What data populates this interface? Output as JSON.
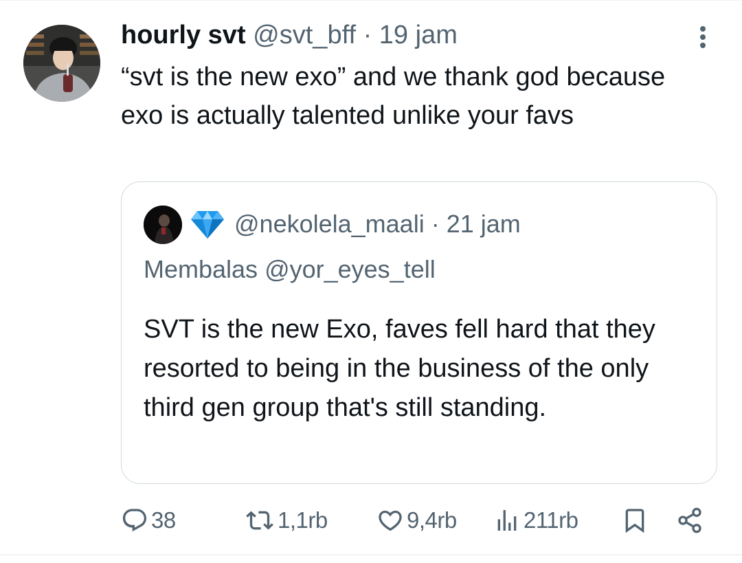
{
  "tweet": {
    "author_name": "hourly svt",
    "handle": "@svt_bff",
    "separator": "·",
    "time": "19 jam",
    "text": "“svt is the new exo” and we thank god because exo is actually talented unlike your favs"
  },
  "quoted_tweet": {
    "handle": "@nekolela_maali",
    "separator": "·",
    "time": "21 jam",
    "replying_to": "Membalas @yor_eyes_tell",
    "text": "SVT is the new Exo, faves fell hard that they resorted to being in the business of the only third gen group that's still standing.",
    "badge_icon": "diamond-icon"
  },
  "actions": {
    "replies": "38",
    "retweets": "1,1rb",
    "likes": "9,4rb",
    "views": "211rb"
  },
  "colors": {
    "text": "#0f1419",
    "muted": "#536471",
    "border": "#cfd9de",
    "gem": "#1d9bf0"
  }
}
